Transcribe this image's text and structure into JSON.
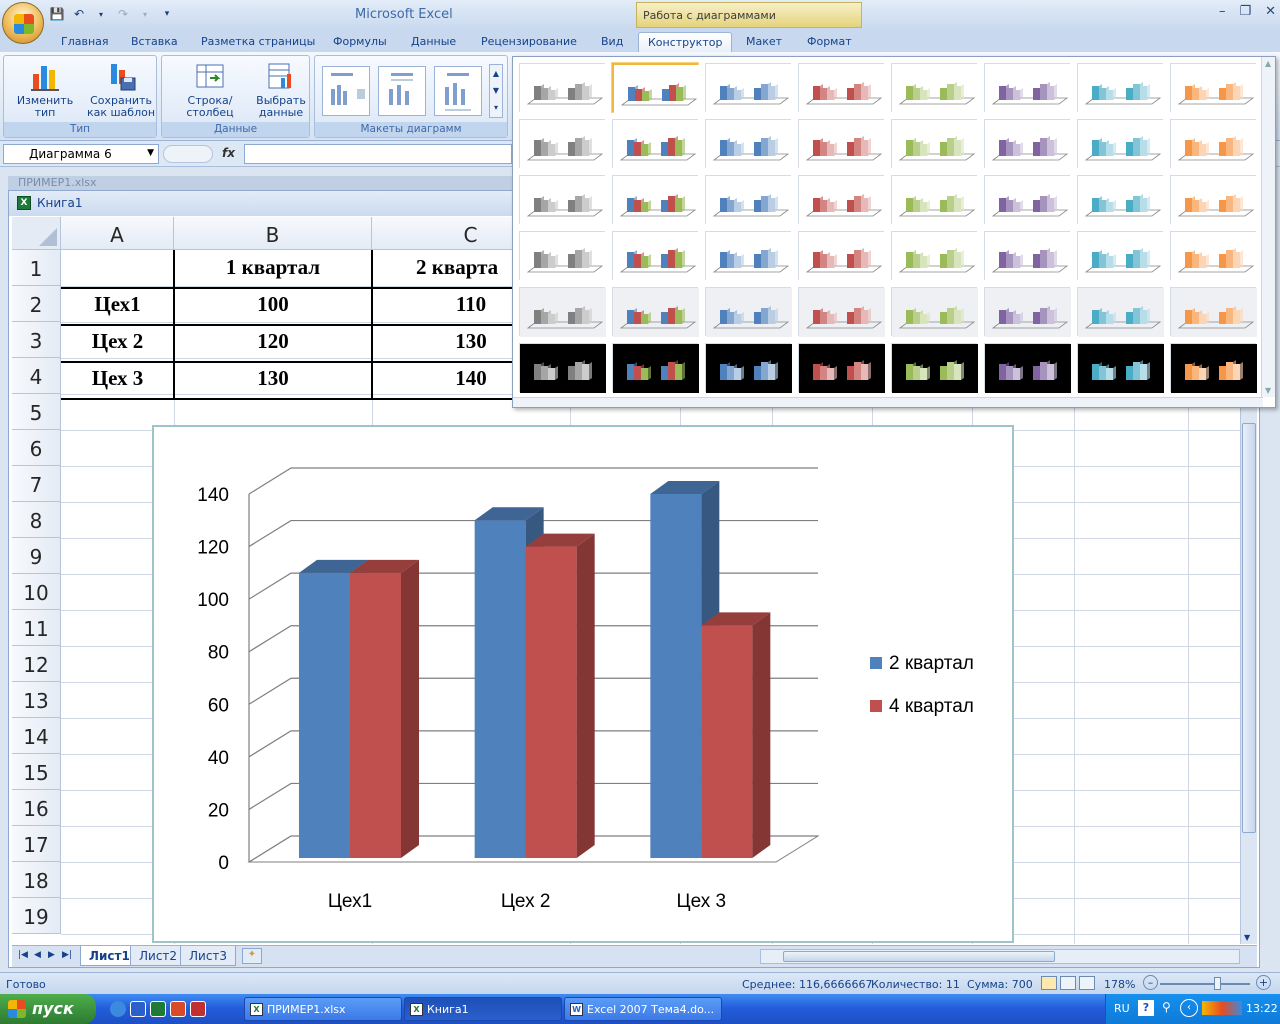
{
  "window": {
    "app_title": "Microsoft Excel",
    "context_tab_title": "Работа с диаграммами"
  },
  "ribbon": {
    "tabs": [
      "Главная",
      "Вставка",
      "Разметка страницы",
      "Формулы",
      "Данные",
      "Рецензирование",
      "Вид",
      "Конструктор",
      "Макет",
      "Формат"
    ],
    "active_tab": "Конструктор",
    "groups": {
      "type": {
        "label": "Тип",
        "change_type": "Изменить тип\nдиаграммы",
        "save_template": "Сохранить\nкак шаблон"
      },
      "data": {
        "label": "Данные",
        "row_col": "Строка/столбец",
        "select_data": "Выбрать\nданные"
      },
      "layouts": {
        "label": "Макеты диаграмм"
      }
    }
  },
  "formula_bar": {
    "name_box": "Диаграмма 6",
    "fx": "fx",
    "formula": ""
  },
  "workbook": {
    "back_title": "ПРИМЕР1.xlsx",
    "title": "Книга1"
  },
  "sheet": {
    "columns": [
      "A",
      "B",
      "C"
    ],
    "rows": [
      "1",
      "2",
      "3",
      "4",
      "5",
      "6",
      "7",
      "8",
      "9",
      "10",
      "11",
      "12",
      "13",
      "14",
      "15",
      "16",
      "17",
      "18",
      "19"
    ],
    "cells": {
      "B1": "1 квартал",
      "C1": "2 кварта",
      "A2": "Цех1",
      "B2": "100",
      "C2": "110",
      "A3": "Цех 2",
      "B3": "120",
      "C3": "130",
      "A4": "Цех 3",
      "B4": "130",
      "C4": "140"
    },
    "tabs": [
      "Лист1",
      "Лист2",
      "Лист3"
    ],
    "active_tab": "Лист1"
  },
  "chart_data": {
    "type": "bar",
    "categories": [
      "Цех1",
      "Цех 2",
      "Цех 3"
    ],
    "series": [
      {
        "name": "2 квартал",
        "values": [
          110,
          130,
          140
        ],
        "color": "#4f81bd"
      },
      {
        "name": "4 квартал",
        "values": [
          110,
          120,
          90
        ],
        "color": "#c0504d"
      }
    ],
    "ylim": [
      0,
      140
    ],
    "yticks": [
      0,
      20,
      40,
      60,
      80,
      100,
      120,
      140
    ],
    "grid": true,
    "legend": "right",
    "style": "3d-column"
  },
  "gallery": {
    "colors": [
      "#808080",
      "multi",
      "#4f81bd",
      "#c0504d",
      "#9bbb59",
      "#8064a2",
      "#4bacc6",
      "#f79646"
    ],
    "rows": 6,
    "selected": [
      0,
      1
    ]
  },
  "statusbar": {
    "ready": "Готово",
    "average": "Среднее: 116,6666667",
    "count": "Количество: 11",
    "sum": "Сумма: 700",
    "zoom": "178%"
  },
  "taskbar": {
    "start": "пуск",
    "buttons": [
      "ПРИМЕР1.xlsx",
      "Книга1",
      "Excel 2007 Тема4.do..."
    ],
    "active_button": "Книга1",
    "lang": "RU",
    "time": "13:22"
  }
}
